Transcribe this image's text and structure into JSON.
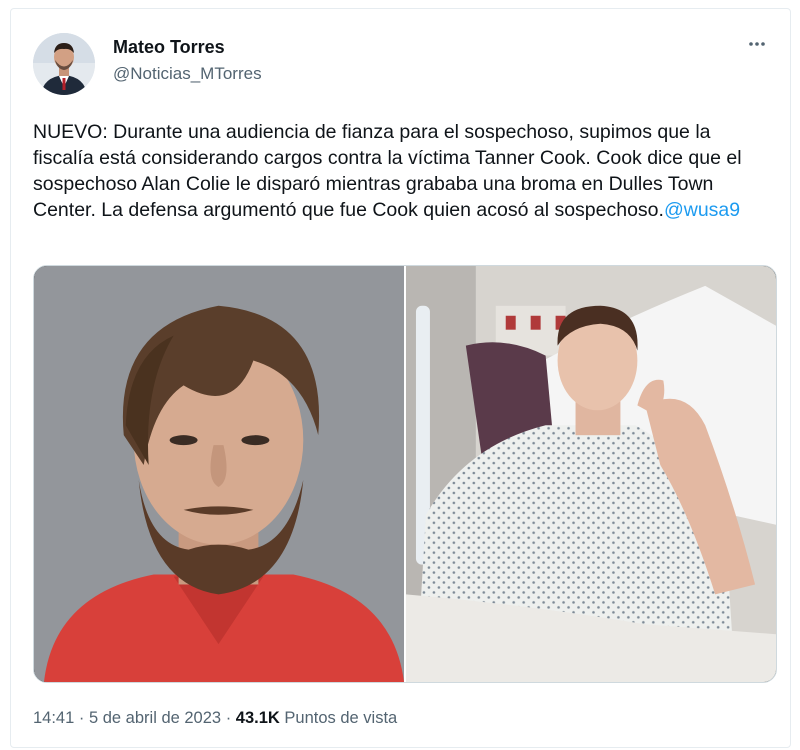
{
  "author": {
    "name": "Mateo Torres",
    "handle": "@Noticias_MTorres"
  },
  "menu_icon": "more-horizontal-icon",
  "tweet": {
    "text": "NUEVO: Durante una audiencia de fianza para el sospechoso, supimos que la fiscalía está considerando cargos contra la víctima Tanner Cook. Cook dice que el sospechoso Alan Colie le disparó mientras grababa una broma en Dulles Town Center. La defensa argumentó que fue Cook quien acosó al sospechoso.",
    "mention": "@wusa9"
  },
  "meta": {
    "time": "14:41",
    "separator": "·",
    "date": "5 de abril de 2023",
    "views_count": "43.1K",
    "views_label": "Puntos de vista"
  },
  "colors": {
    "link": "#1d9bf0",
    "secondary_text": "#536471",
    "primary_text": "#0f1419"
  }
}
